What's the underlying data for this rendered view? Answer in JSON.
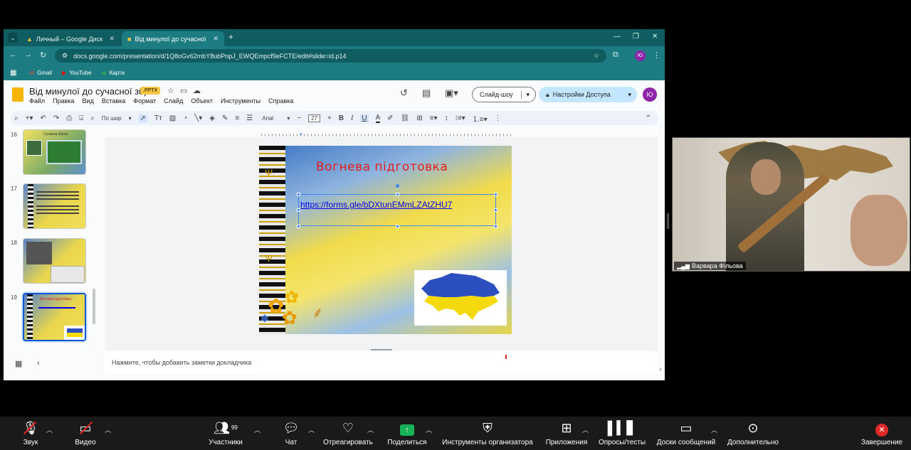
{
  "browser": {
    "tabs": [
      {
        "title": "Личный – Google Диск",
        "active": false
      },
      {
        "title": "Від минулої до сучасної зброї",
        "active": true
      }
    ],
    "new_tab": "+",
    "url": "docs.google.com/presentation/d/1Q8oGv62mbY8ubPnpJ_EWQEmpcf9eFCTE/edit#slide=id.p14",
    "bookmarks": [
      "Gmail",
      "YouTube",
      "Карти"
    ]
  },
  "docs": {
    "title": "Від минулої до сучасної зброї",
    "badge": ".PPTX",
    "menu": [
      "Файл",
      "Правка",
      "Вид",
      "Вставка",
      "Формат",
      "Слайд",
      "Объект",
      "Инструменты",
      "Справка"
    ],
    "slideshow_button": "Слайд-шоу",
    "share_button": "Настройки Доступа",
    "avatar": "Ю",
    "toolbar": {
      "fit": "По шир",
      "font": "Arial",
      "size": "27"
    },
    "notes_placeholder": "Нажмите, чтобы добавить заметки докладчика"
  },
  "slides": {
    "thumbnails": [
      {
        "num": "16",
        "caption": "Сучасна зброя"
      },
      {
        "num": "17",
        "caption": ""
      },
      {
        "num": "18",
        "caption": ""
      },
      {
        "num": "19",
        "caption": "Вогнева підготовка",
        "selected": true
      }
    ],
    "current": {
      "title": "Вогнева  підготовка",
      "link": "https://forms.gle/bDXtunEMmLZAtZHU7"
    }
  },
  "webcam": {
    "name": "Варвара Фільова"
  },
  "zoom": {
    "participants_count": "99",
    "buttons": [
      "Звук",
      "Видео",
      "Участники",
      "Чат",
      "Отреагировать",
      "Поделиться",
      "Инструменты организатора",
      "Приложения",
      "Опросы/тесты",
      "Доски сообщений",
      "Дополнительно",
      "Завершение"
    ]
  },
  "colors": {
    "accent": "#1c7c82",
    "share": "#c2e7ff",
    "slide_title": "#e21d1d",
    "end": "#e02828"
  }
}
